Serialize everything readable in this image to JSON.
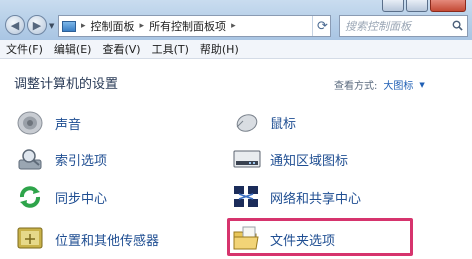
{
  "address": {
    "crumbs": [
      "控制面板",
      "所有控制面板项"
    ]
  },
  "search": {
    "placeholder": "搜索控制面板"
  },
  "menu": [
    "文件(F)",
    "编辑(E)",
    "查看(V)",
    "工具(T)",
    "帮助(H)"
  ],
  "content": {
    "heading": "调整计算机的设置",
    "view_by_label": "查看方式:",
    "view_by_value": "大图标"
  },
  "items": {
    "sound": "声音",
    "mouse": "鼠标",
    "indexing": "索引选项",
    "notify": "通知区域图标",
    "sync": "同步中心",
    "network": "网络和共享中心",
    "location": "位置和其他传感器",
    "folder": "文件夹选项"
  },
  "colors": {
    "highlight_border": "#d6346d",
    "link": "#1f4e92"
  }
}
